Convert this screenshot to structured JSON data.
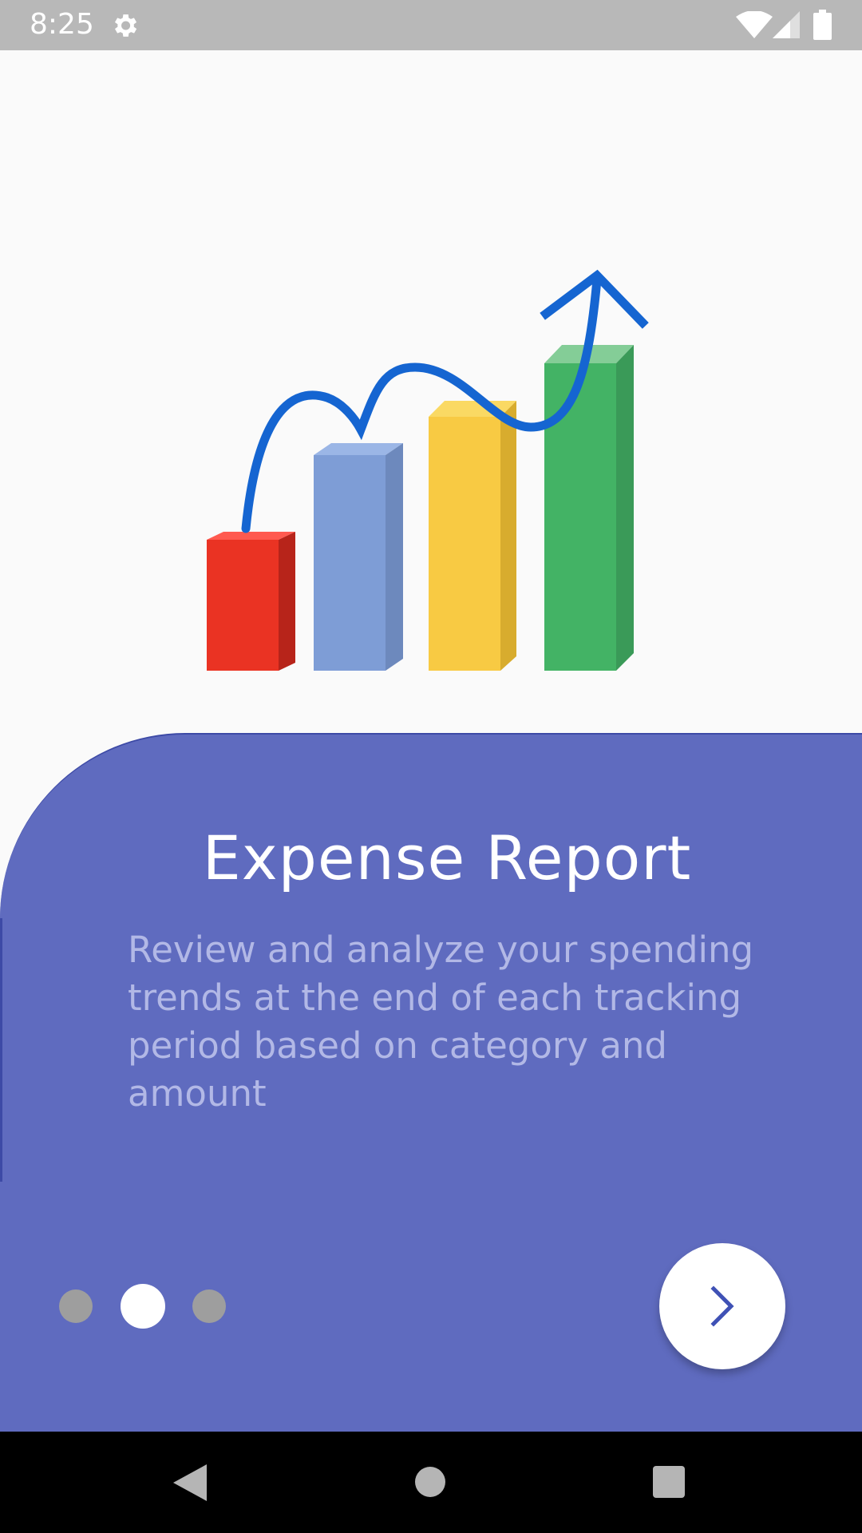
{
  "status_bar": {
    "time": "8:25",
    "icons": [
      "gear-icon",
      "wifi-icon",
      "cell-signal-icon",
      "battery-icon"
    ]
  },
  "illustration": {
    "icon": "bar-chart-growth-illustration",
    "bar_colors": [
      "#ea3323",
      "#7e9dd6",
      "#f8ca43",
      "#43b365"
    ],
    "arrow_color": "#1565d1"
  },
  "onboarding": {
    "title": "Expense Report",
    "description": "Review and analyze your spending trends at the end of each tracking period based on category and amount",
    "pager": {
      "total_pages": 3,
      "current_page": 2
    },
    "next_button": {
      "icon": "chevron-right-icon"
    }
  },
  "navigation_bar": {
    "icons": [
      "back-icon",
      "home-icon",
      "recent-apps-icon"
    ]
  },
  "colors": {
    "accent": "#5f6bbf",
    "title_text": "#ffffff",
    "description_text": "#b2b8e6",
    "dot_active": "#ffffff",
    "dot_inactive": "#9e9e9e",
    "chevron": "#3f51b5"
  }
}
